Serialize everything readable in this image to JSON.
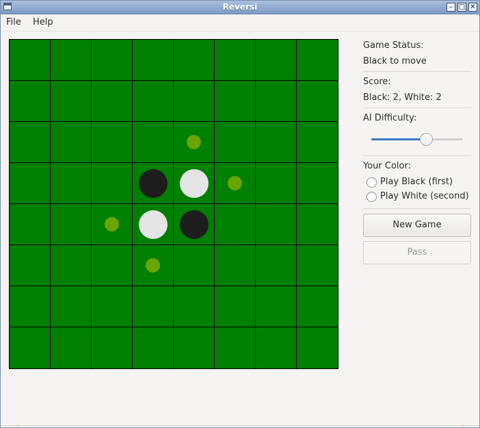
{
  "window": {
    "title": "Reversi"
  },
  "menu": {
    "file": "File",
    "help": "Help"
  },
  "board": {
    "size": 8,
    "colors": {
      "felt": "#008000",
      "grid": "#000000",
      "black": "#1d1d1d",
      "white": "#e5e5e5",
      "hint": "#6aa400"
    },
    "pieces": [
      {
        "row": 3,
        "col": 3,
        "color": "black"
      },
      {
        "row": 3,
        "col": 4,
        "color": "white"
      },
      {
        "row": 4,
        "col": 3,
        "color": "white"
      },
      {
        "row": 4,
        "col": 4,
        "color": "black"
      }
    ],
    "legal_moves": [
      {
        "row": 2,
        "col": 4
      },
      {
        "row": 3,
        "col": 5
      },
      {
        "row": 4,
        "col": 2
      },
      {
        "row": 5,
        "col": 3
      }
    ]
  },
  "status": {
    "heading": "Game Status:",
    "value": "Black to move"
  },
  "score": {
    "heading": "Score:",
    "value": "Black: 2, White: 2"
  },
  "difficulty": {
    "heading": "AI Difficulty:",
    "level": 0.6
  },
  "color_choice": {
    "heading": "Your Color:",
    "options": [
      {
        "label": "Play Black (first)",
        "selected": false
      },
      {
        "label": "Play White (second)",
        "selected": false
      }
    ]
  },
  "buttons": {
    "new_game": "New Game",
    "pass": "Pass"
  }
}
